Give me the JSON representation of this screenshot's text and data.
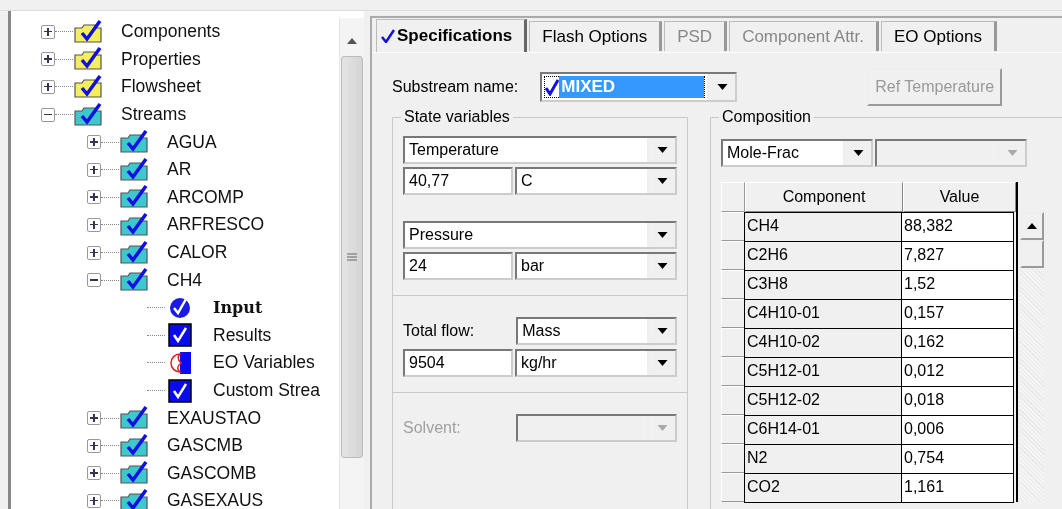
{
  "tree": [
    {
      "label": "Components",
      "kind": "group",
      "expanded": false,
      "selected": false
    },
    {
      "label": "Properties",
      "kind": "group",
      "expanded": false,
      "selected": false
    },
    {
      "label": "Flowsheet",
      "kind": "group",
      "expanded": false,
      "selected": false
    },
    {
      "label": "Streams",
      "kind": "stream",
      "expanded": true,
      "selected": false,
      "children": [
        {
          "label": "AGUA",
          "kind": "stream",
          "expanded": false,
          "selected": false
        },
        {
          "label": "AR",
          "kind": "stream",
          "expanded": false,
          "selected": false
        },
        {
          "label": "ARCOMP",
          "kind": "stream",
          "expanded": false,
          "selected": false
        },
        {
          "label": "ARFRESCO",
          "kind": "stream",
          "expanded": false,
          "selected": false
        },
        {
          "label": "CALOR",
          "kind": "stream",
          "expanded": false,
          "selected": false
        },
        {
          "label": "CH4",
          "kind": "stream",
          "expanded": true,
          "selected": false,
          "children": [
            {
              "label": "Input",
              "kind": "input",
              "selected": true
            },
            {
              "label": "Results",
              "kind": "results",
              "selected": false
            },
            {
              "label": "EO Variables",
              "kind": "eo",
              "selected": false
            },
            {
              "label": "Custom Strea",
              "kind": "results",
              "selected": false
            }
          ]
        },
        {
          "label": "EXAUSTAO",
          "kind": "stream",
          "expanded": false,
          "selected": false
        },
        {
          "label": "GASCMB",
          "kind": "stream",
          "expanded": false,
          "selected": false
        },
        {
          "label": "GASCOMB",
          "kind": "stream",
          "expanded": false,
          "selected": false
        },
        {
          "label": "GASEXAUS",
          "kind": "stream",
          "expanded": false,
          "selected": false
        }
      ]
    }
  ],
  "tabs": [
    {
      "label": "Specifications",
      "selected": true,
      "disabled": false,
      "checked": true
    },
    {
      "label": "Flash Options",
      "selected": false,
      "disabled": false,
      "checked": false
    },
    {
      "label": "PSD",
      "selected": false,
      "disabled": true,
      "checked": false
    },
    {
      "label": "Component Attr.",
      "selected": false,
      "disabled": true,
      "checked": false
    },
    {
      "label": "EO Options",
      "selected": false,
      "disabled": false,
      "checked": false
    }
  ],
  "substream": {
    "label": "Substream name:",
    "value": "MIXED",
    "checked": true
  },
  "ref_temperature_button": {
    "label": "Ref Temperature",
    "disabled": true
  },
  "state_variables": {
    "title": "State variables",
    "temperature": {
      "variable": "Temperature",
      "value": "40,77",
      "unit": "C"
    },
    "pressure": {
      "variable": "Pressure",
      "value": "24",
      "unit": "bar"
    },
    "total_flow": {
      "label": "Total flow:",
      "basis": "Mass",
      "value": "9504",
      "unit": "kg/hr"
    },
    "solvent": {
      "label": "Solvent:",
      "disabled": true
    }
  },
  "composition": {
    "title": "Composition",
    "basis": "Mole-Frac",
    "second_disabled": true,
    "columns": [
      "Component",
      "Value"
    ],
    "rows": [
      {
        "component": "CH4",
        "value": "88,382"
      },
      {
        "component": "C2H6",
        "value": "7,827"
      },
      {
        "component": "C3H8",
        "value": "1,52"
      },
      {
        "component": "C4H10-01",
        "value": "0,157"
      },
      {
        "component": "C4H10-02",
        "value": "0,162"
      },
      {
        "component": "C5H12-01",
        "value": "0,012"
      },
      {
        "component": "C5H12-02",
        "value": "0,018"
      },
      {
        "component": "C6H14-01",
        "value": "0,006"
      },
      {
        "component": "N2",
        "value": "0,754"
      },
      {
        "component": "CO2",
        "value": "1,161"
      }
    ]
  }
}
